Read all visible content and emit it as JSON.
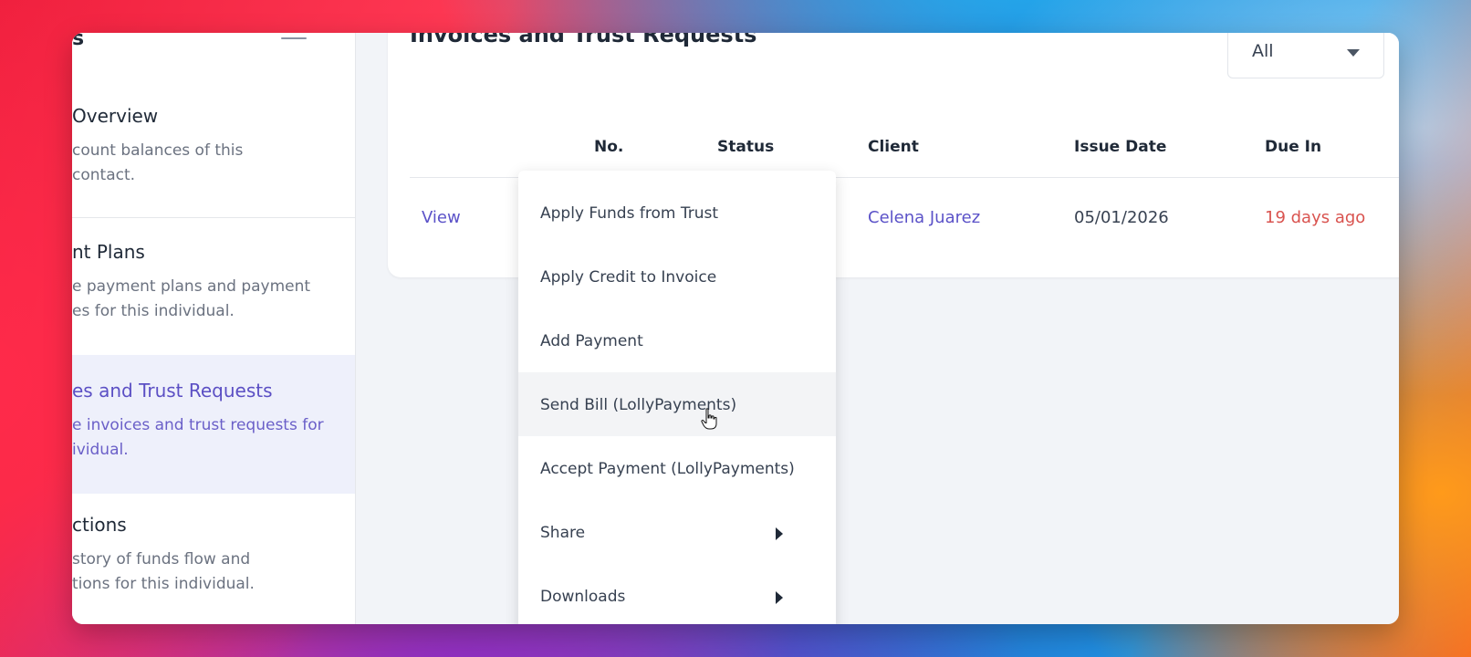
{
  "sidebar": {
    "brand": "s",
    "items": [
      {
        "title": "Overview",
        "desc1": "count balances of this",
        "desc2": "contact."
      },
      {
        "title": "nt Plans",
        "desc1": "e payment plans and payment",
        "desc2": "es for this individual."
      },
      {
        "title": "es and Trust Requests",
        "desc1": "e invoices and trust requests for",
        "desc2": "ividual."
      },
      {
        "title": "ctions",
        "desc1": "story of funds flow and",
        "desc2": "tions for this individual."
      }
    ]
  },
  "main": {
    "title": "Invoices and Trust Requests",
    "filter": {
      "selected": "All"
    },
    "columns": [
      "No.",
      "Status",
      "Client",
      "Issue Date",
      "Due In"
    ],
    "rows": [
      {
        "action": "View",
        "client": "Celena Juarez",
        "issue_date": "05/01/2026",
        "due_in": "19 days ago"
      }
    ]
  },
  "context_menu": {
    "items": [
      {
        "label": "Apply Funds from Trust"
      },
      {
        "label": "Apply Credit to Invoice"
      },
      {
        "label": "Add Payment"
      },
      {
        "label": "Send Bill (LollyPayments)"
      },
      {
        "label": "Accept Payment (LollyPayments)"
      },
      {
        "label": "Share"
      },
      {
        "label": "Downloads"
      }
    ]
  },
  "colors": {
    "accent": "#5b52c8",
    "overdue": "#d9534f",
    "active_bg": "#eef0fb"
  },
  "icons": [
    "hamburger-icon",
    "chevron-down-icon",
    "chevron-right-icon",
    "hand-pointer-icon"
  ]
}
